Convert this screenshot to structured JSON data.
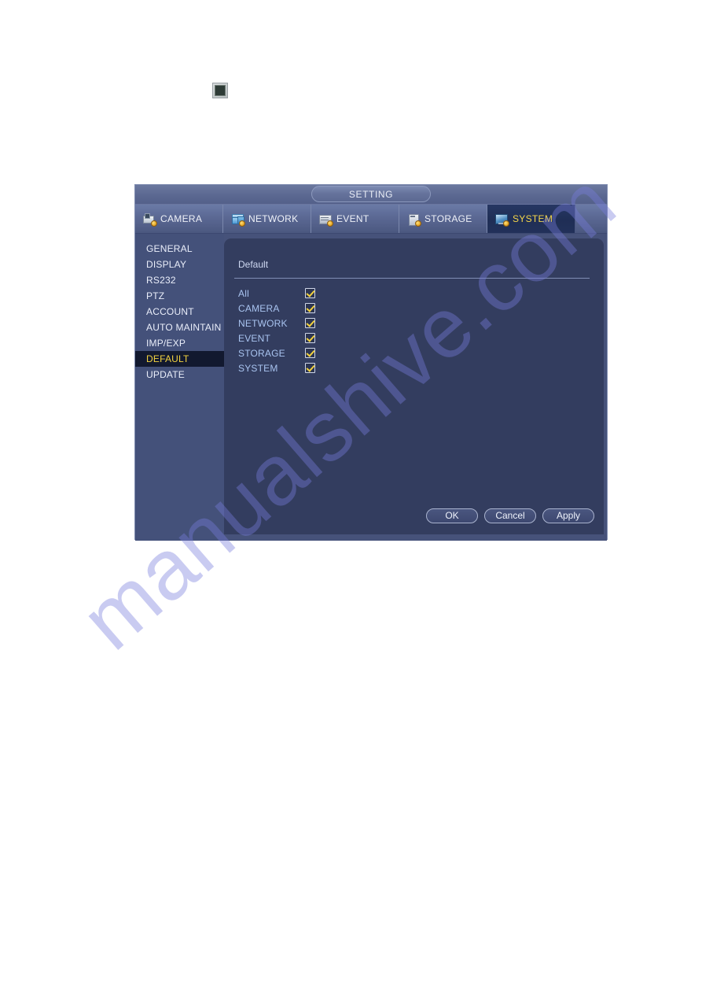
{
  "page": {
    "background_color": "#ffffff",
    "watermark_text": "manualshive.com",
    "watermark_color": "#787cdc"
  },
  "top_icon": {
    "name": "square-device-icon",
    "label": ""
  },
  "dialog": {
    "title": "SETTING",
    "accent_color": "#f2d23f",
    "panel_color": "#333d5f",
    "sidebar_color": "#44517a"
  },
  "tabs": [
    {
      "label": "CAMERA",
      "icon": "camera-icon",
      "active": false
    },
    {
      "label": "NETWORK",
      "icon": "network-icon",
      "active": false
    },
    {
      "label": "EVENT",
      "icon": "event-icon",
      "active": false
    },
    {
      "label": "STORAGE",
      "icon": "storage-icon",
      "active": false
    },
    {
      "label": "SYSTEM",
      "icon": "system-icon",
      "active": true
    }
  ],
  "sidebar": {
    "items": [
      {
        "label": "GENERAL",
        "active": false
      },
      {
        "label": "DISPLAY",
        "active": false
      },
      {
        "label": "RS232",
        "active": false
      },
      {
        "label": "PTZ",
        "active": false
      },
      {
        "label": "ACCOUNT",
        "active": false
      },
      {
        "label": "AUTO MAINTAIN",
        "active": false
      },
      {
        "label": "IMP/EXP",
        "active": false
      },
      {
        "label": "DEFAULT",
        "active": true
      },
      {
        "label": "UPDATE",
        "active": false
      }
    ]
  },
  "content": {
    "section_title": "Default",
    "options": [
      {
        "label": "All",
        "checked": true
      },
      {
        "label": "CAMERA",
        "checked": true
      },
      {
        "label": "NETWORK",
        "checked": true
      },
      {
        "label": "EVENT",
        "checked": true
      },
      {
        "label": "STORAGE",
        "checked": true
      },
      {
        "label": "SYSTEM",
        "checked": true
      }
    ],
    "buttons": [
      {
        "label": "OK"
      },
      {
        "label": "Cancel"
      },
      {
        "label": "Apply"
      }
    ]
  }
}
